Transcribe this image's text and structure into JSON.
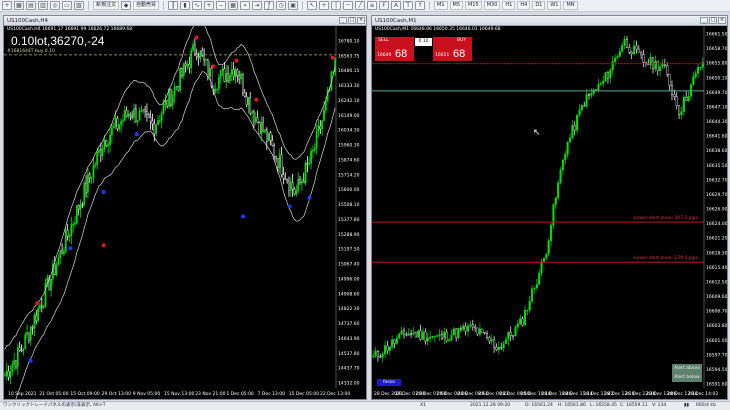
{
  "toolbar": {
    "new_order_label": "新規注文",
    "algo_label": "自動売買"
  },
  "left_chart": {
    "title": "US100Cash,H4",
    "ohlc": "US100Cash,H4  16691.17  16691.99  16626.72  16689.68",
    "info_label": "0.10lot,36270,-24",
    "hline_label": "#1681644T buy 0.10",
    "price_ticks": [
      "16780.10",
      "16563.75",
      "16480.15",
      "16333.30",
      "16242.10",
      "16149.00",
      "16034.30",
      "15960.30",
      "15874.60",
      "15714.20",
      "15600.00",
      "15508.10",
      "15377.80",
      "15288.90",
      "15197.50",
      "15067.40",
      "14996.00",
      "14908.60",
      "14822.30",
      "14737.60",
      "14643.90",
      "14537.80",
      "14437.70",
      "14332.00"
    ],
    "time_ticks": [
      "10 Sep 2021",
      "21 Oct 05:00",
      "15 Oct 09:00",
      "29 Oct 13:00",
      "9 Nov 05:00",
      "15 Nov 13:00",
      "23 Nov 21:00",
      "1 Dec 05:00",
      "7 Dec 13:00",
      "15 Dec 05:00",
      "22 Dec 13:00"
    ],
    "price_range": [
      14332,
      16840
    ]
  },
  "right_chart": {
    "title": "US100Cash,M1",
    "ohlc": "US100Cash,M1  16648.06  16650.35  16646.01  16649.68",
    "sell_label": "SELL",
    "buy_label": "BUY",
    "lot": "0.10",
    "sell_small": "16649",
    "sell_big": "68",
    "buy_small": "16651",
    "buy_big": "68",
    "price_ticks": [
      "16661.50",
      "16658.70",
      "16655.80",
      "16650.10",
      "16649.70",
      "16647.10",
      "16644.30",
      "16641.60",
      "16638.60",
      "16635.50",
      "16632.70",
      "16629.70",
      "16626.90",
      "16624.00",
      "16621.20",
      "16618.30",
      "16615.40",
      "16612.50",
      "16609.60",
      "16606.70",
      "16603.80",
      "16601.00",
      "16597.70",
      "16594.50",
      "16591.60"
    ],
    "time_ticks": [
      "28 Dec 2021",
      "28 Dec 07:30",
      "28 Dec 07:58",
      "28 Dec 08:26",
      "28 Dec 08:54",
      "28 Dec 09:22",
      "28 Dec 09:50",
      "28 Dec 10:18",
      "28 Dec 10:46",
      "28 Dec 11:14",
      "28 Dec 11:42",
      "28 Dec 12:10",
      "28 Dec 12:38",
      "28 Dec 13:06",
      "28 Dec 13:34",
      "28 Dec 14:02"
    ],
    "price_range": [
      16591,
      16663
    ],
    "alert_lines": [
      {
        "label": "Lower alert level: 347.0 pips",
        "price": 16624
      },
      {
        "label": "Lower alert level: 129.4 pips",
        "price": 16616
      }
    ],
    "current_price": 16650.1,
    "alert_box": [
      "Alert above",
      "Alert below"
    ],
    "blue_tag": "fesso"
  },
  "status": {
    "left": "ワンクリックトレードパネルの表示/非表示, Alt+T",
    "profile": "X1",
    "datetime": "2021.12.28 09:20",
    "o": "O: 16561.24",
    "h": "H: 16561.86",
    "l": "L: 16558.45",
    "c": "C: 16559.11",
    "v": "V: 134",
    "conn": "660/4 kb"
  },
  "colors": {
    "bull": "#00e000",
    "bear": "#ffffff",
    "envelope": "#d8d8d8",
    "alert_line": "#c8101e",
    "price_line": "#53a8a8",
    "buy_line": "#b8b862"
  }
}
